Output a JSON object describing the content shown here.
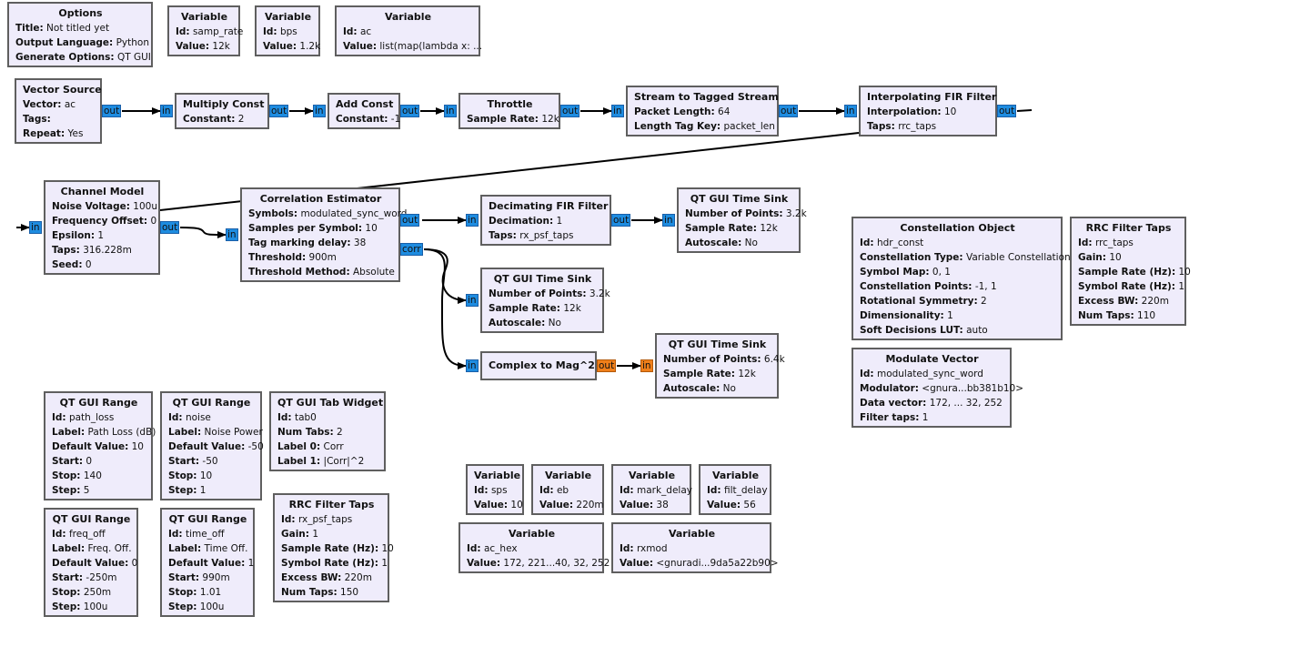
{
  "blocks": {
    "options": {
      "title": "Options",
      "rows": [
        [
          "Title:",
          "Not titled yet"
        ],
        [
          "Output Language:",
          "Python"
        ],
        [
          "Generate Options:",
          "QT GUI"
        ]
      ]
    },
    "var_samp_rate": {
      "title": "Variable",
      "rows": [
        [
          "Id:",
          "samp_rate"
        ],
        [
          "Value:",
          "12k"
        ]
      ]
    },
    "var_bps": {
      "title": "Variable",
      "rows": [
        [
          "Id:",
          "bps"
        ],
        [
          "Value:",
          "1.2k"
        ]
      ]
    },
    "var_ac": {
      "title": "Variable",
      "rows": [
        [
          "Id:",
          "ac"
        ],
        [
          "Value:",
          "list(map(lambda x: ..."
        ]
      ]
    },
    "vector_source": {
      "title": "Vector Source",
      "rows": [
        [
          "Vector:",
          "ac"
        ],
        [
          "Tags:",
          ""
        ],
        [
          "Repeat:",
          "Yes"
        ]
      ]
    },
    "multiply_const": {
      "title": "Multiply Const",
      "rows": [
        [
          "Constant:",
          "2"
        ]
      ]
    },
    "add_const": {
      "title": "Add Const",
      "rows": [
        [
          "Constant:",
          "-1"
        ]
      ]
    },
    "throttle": {
      "title": "Throttle",
      "rows": [
        [
          "Sample Rate:",
          "12k"
        ]
      ]
    },
    "stream_to_tagged": {
      "title": "Stream to Tagged Stream",
      "rows": [
        [
          "Packet Length:",
          "64"
        ],
        [
          "Length Tag Key:",
          "packet_len"
        ]
      ]
    },
    "interp_fir": {
      "title": "Interpolating FIR Filter",
      "rows": [
        [
          "Interpolation:",
          "10"
        ],
        [
          "Taps:",
          "rrc_taps"
        ]
      ]
    },
    "channel_model": {
      "title": "Channel Model",
      "rows": [
        [
          "Noise Voltage:",
          "100u"
        ],
        [
          "Frequency Offset:",
          "0"
        ],
        [
          "Epsilon:",
          "1"
        ],
        [
          "Taps:",
          "316.228m"
        ],
        [
          "Seed:",
          "0"
        ]
      ]
    },
    "corr_est": {
      "title": "Correlation Estimator",
      "rows": [
        [
          "Symbols:",
          "modulated_sync_word"
        ],
        [
          "Samples per Symbol:",
          "10"
        ],
        [
          "Tag marking delay:",
          "38"
        ],
        [
          "Threshold:",
          "900m"
        ],
        [
          "Threshold Method:",
          "Absolute"
        ]
      ]
    },
    "decim_fir": {
      "title": "Decimating FIR Filter",
      "rows": [
        [
          "Decimation:",
          "1"
        ],
        [
          "Taps:",
          "rx_psf_taps"
        ]
      ]
    },
    "time_sink_1": {
      "title": "QT GUI Time Sink",
      "rows": [
        [
          "Number of Points:",
          "3.2k"
        ],
        [
          "Sample Rate:",
          "12k"
        ],
        [
          "Autoscale:",
          "No"
        ]
      ]
    },
    "time_sink_2": {
      "title": "QT GUI Time Sink",
      "rows": [
        [
          "Number of Points:",
          "3.2k"
        ],
        [
          "Sample Rate:",
          "12k"
        ],
        [
          "Autoscale:",
          "No"
        ]
      ]
    },
    "complex_mag2": {
      "title": "Complex to Mag^2",
      "rows": []
    },
    "time_sink_3": {
      "title": "QT GUI Time Sink",
      "rows": [
        [
          "Number of Points:",
          "6.4k"
        ],
        [
          "Sample Rate:",
          "12k"
        ],
        [
          "Autoscale:",
          "No"
        ]
      ]
    },
    "constellation": {
      "title": "Constellation Object",
      "rows": [
        [
          "Id:",
          "hdr_const"
        ],
        [
          "Constellation Type:",
          "Variable Constellation"
        ],
        [
          "Symbol Map:",
          "0, 1"
        ],
        [
          "Constellation Points:",
          "-1, 1"
        ],
        [
          "Rotational Symmetry:",
          "2"
        ],
        [
          "Dimensionality:",
          "1"
        ],
        [
          "Soft Decisions LUT:",
          "auto"
        ]
      ]
    },
    "rrc_taps": {
      "title": "RRC Filter Taps",
      "rows": [
        [
          "Id:",
          "rrc_taps"
        ],
        [
          "Gain:",
          "10"
        ],
        [
          "Sample Rate (Hz):",
          "10"
        ],
        [
          "Symbol Rate (Hz):",
          "1"
        ],
        [
          "Excess BW:",
          "220m"
        ],
        [
          "Num Taps:",
          "110"
        ]
      ]
    },
    "modulate_vector": {
      "title": "Modulate Vector",
      "rows": [
        [
          "Id:",
          "modulated_sync_word"
        ],
        [
          "Modulator:",
          "<gnura...bb381b10>"
        ],
        [
          "Data vector:",
          "172, ... 32, 252"
        ],
        [
          "Filter taps:",
          "1"
        ]
      ]
    },
    "range_path_loss": {
      "title": "QT GUI Range",
      "rows": [
        [
          "Id:",
          "path_loss"
        ],
        [
          "Label:",
          "Path Loss (dB)"
        ],
        [
          "Default Value:",
          "10"
        ],
        [
          "Start:",
          "0"
        ],
        [
          "Stop:",
          "140"
        ],
        [
          "Step:",
          "5"
        ]
      ]
    },
    "range_noise": {
      "title": "QT GUI Range",
      "rows": [
        [
          "Id:",
          "noise"
        ],
        [
          "Label:",
          "Noise Power"
        ],
        [
          "Default Value:",
          "-50"
        ],
        [
          "Start:",
          "-50"
        ],
        [
          "Stop:",
          "10"
        ],
        [
          "Step:",
          "1"
        ]
      ]
    },
    "tab_widget": {
      "title": "QT GUI Tab Widget",
      "rows": [
        [
          "Id:",
          "tab0"
        ],
        [
          "Num Tabs:",
          "2"
        ],
        [
          "Label 0:",
          "Corr"
        ],
        [
          "Label 1:",
          "|Corr|^2"
        ]
      ]
    },
    "range_freq_off": {
      "title": "QT GUI Range",
      "rows": [
        [
          "Id:",
          "freq_off"
        ],
        [
          "Label:",
          "Freq. Off."
        ],
        [
          "Default Value:",
          "0"
        ],
        [
          "Start:",
          "-250m"
        ],
        [
          "Stop:",
          "250m"
        ],
        [
          "Step:",
          "100u"
        ]
      ]
    },
    "range_time_off": {
      "title": "QT GUI Range",
      "rows": [
        [
          "Id:",
          "time_off"
        ],
        [
          "Label:",
          "Time Off."
        ],
        [
          "Default Value:",
          "1"
        ],
        [
          "Start:",
          "990m"
        ],
        [
          "Stop:",
          "1.01"
        ],
        [
          "Step:",
          "100u"
        ]
      ]
    },
    "rx_psf_taps": {
      "title": "RRC Filter Taps",
      "rows": [
        [
          "Id:",
          "rx_psf_taps"
        ],
        [
          "Gain:",
          "1"
        ],
        [
          "Sample Rate (Hz):",
          "10"
        ],
        [
          "Symbol Rate (Hz):",
          "1"
        ],
        [
          "Excess BW:",
          "220m"
        ],
        [
          "Num Taps:",
          "150"
        ]
      ]
    },
    "var_sps": {
      "title": "Variable",
      "rows": [
        [
          "Id:",
          "sps"
        ],
        [
          "Value:",
          "10"
        ]
      ]
    },
    "var_eb": {
      "title": "Variable",
      "rows": [
        [
          "Id:",
          "eb"
        ],
        [
          "Value:",
          "220m"
        ]
      ]
    },
    "var_mark_delay": {
      "title": "Variable",
      "rows": [
        [
          "Id:",
          "mark_delay"
        ],
        [
          "Value:",
          "38"
        ]
      ]
    },
    "var_filt_delay": {
      "title": "Variable",
      "rows": [
        [
          "Id:",
          "filt_delay"
        ],
        [
          "Value:",
          "56"
        ]
      ]
    },
    "var_ac_hex": {
      "title": "Variable",
      "rows": [
        [
          "Id:",
          "ac_hex"
        ],
        [
          "Value:",
          "172, 221...40, 32, 252"
        ]
      ]
    },
    "var_rxmod": {
      "title": "Variable",
      "rows": [
        [
          "Id:",
          "rxmod"
        ],
        [
          "Value:",
          "<gnuradi...9da5a22b90>"
        ]
      ]
    }
  },
  "ports": {
    "in": "in",
    "out": "out",
    "corr": "corr"
  },
  "colors": {
    "block_fill": "#efecfb",
    "block_border": "#5f5f5f",
    "port_complex": "#1e8ce0",
    "port_float": "#ef7f1a",
    "wire": "#000000"
  }
}
